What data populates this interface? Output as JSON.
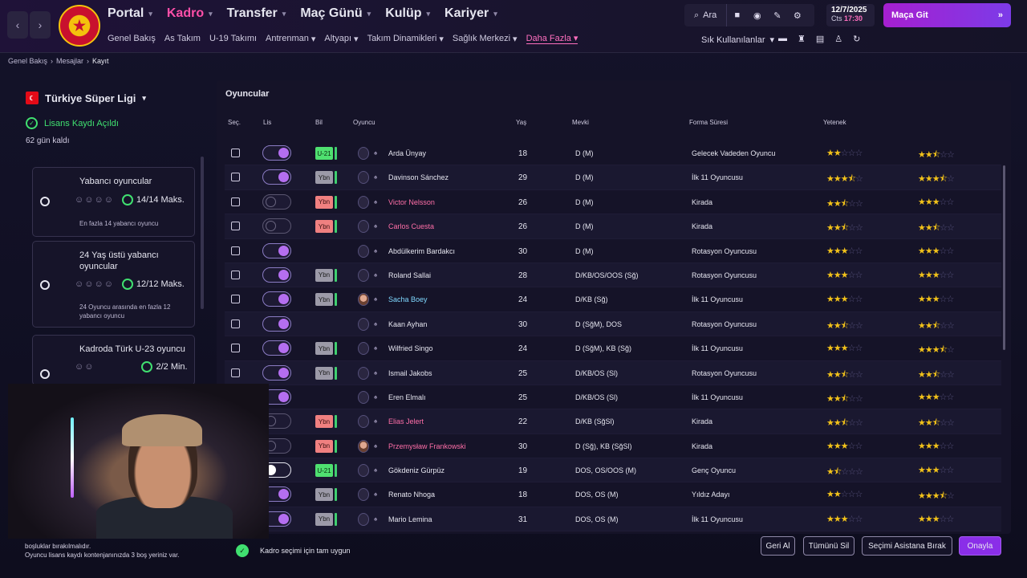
{
  "topbar": {
    "main_nav": [
      "Portal",
      "Kadro",
      "Transfer",
      "Maç Günü",
      "Kulüp",
      "Kariyer"
    ],
    "active_main": "Kadro",
    "sub_nav": [
      "Genel Bakış",
      "As Takım",
      "U-19 Takımı",
      "Antrenman",
      "Altyapı",
      "Takım Dinamikleri",
      "Sağlık Merkezi",
      "Daha Fazla"
    ],
    "active_sub": "Daha Fazla",
    "search_label": "Ara",
    "date": "12/7/2025",
    "day": "Cts",
    "time": "17:30",
    "continue_label": "Maça Git",
    "shortcuts_label": "Sık Kullanılanlar"
  },
  "breadcrumb": [
    "Genel Bakış",
    "Mesajlar",
    "Kayıt"
  ],
  "left": {
    "league": "Türkiye Süper Ligi",
    "license_status": "Lisans Kaydı Açıldı",
    "days_left": "62 gün kaldı",
    "rules": [
      {
        "title": "Yabancı oyuncular",
        "stat": "14/14 Maks.",
        "desc": "En fazla 14 yabancı oyuncu"
      },
      {
        "title": "24 Yaş üstü yabancı oyuncular",
        "stat": "12/12 Maks.",
        "desc": "24 Oyuncu arasında en fazla 12 yabancı oyuncu"
      },
      {
        "title": "Kadroda Türk U-23 oyuncu",
        "stat": "2/2 Min.",
        "desc": ""
      }
    ],
    "notes": [
      "boşluklar bırakılmalıdır.",
      "Oyuncu lisans kaydı kontenjanınızda 3 boş yeriniz var."
    ]
  },
  "table": {
    "title": "Oyuncular",
    "headers": [
      "Seç.",
      "Lis",
      "Bil",
      "Oyuncu",
      "Yaş",
      "Mevki",
      "Forma Süresi",
      "Yetenek"
    ],
    "rows": [
      {
        "name": "Arda Ünyay",
        "age": "18",
        "pos": "D (M)",
        "role": "Gelecek Vadeden Oyuncu",
        "badge": "U-21",
        "toggle": "on",
        "name_style": "normal",
        "ability": 2,
        "potential": 2.5
      },
      {
        "name": "Davinson Sánchez",
        "age": "29",
        "pos": "D (M)",
        "role": "İlk 11 Oyuncusu",
        "badge": "Ybn",
        "toggle": "on",
        "name_style": "normal",
        "ability": 3.5,
        "potential": 3.5
      },
      {
        "name": "Victor Nelsson",
        "age": "26",
        "pos": "D (M)",
        "role": "Kirada",
        "badge": "Ybn-red",
        "toggle": "off",
        "name_style": "loan",
        "ability": 2.5,
        "potential": 3
      },
      {
        "name": "Carlos Cuesta",
        "age": "26",
        "pos": "D (M)",
        "role": "Kirada",
        "badge": "Ybn-red",
        "toggle": "off",
        "name_style": "loan",
        "ability": 2.5,
        "potential": 2.5
      },
      {
        "name": "Abdülkerim Bardakcı",
        "age": "30",
        "pos": "D (M)",
        "role": "Rotasyon Oyuncusu",
        "badge": "",
        "toggle": "on",
        "name_style": "normal",
        "ability": 3,
        "potential": 3
      },
      {
        "name": "Roland Sallai",
        "age": "28",
        "pos": "D/KB/OS/OOS (Sğ)",
        "role": "Rotasyon Oyuncusu",
        "badge": "Ybn",
        "toggle": "on",
        "name_style": "normal",
        "ability": 3,
        "potential": 3
      },
      {
        "name": "Sacha Boey",
        "age": "24",
        "pos": "D/KB (Sğ)",
        "role": "İlk 11 Oyuncusu",
        "badge": "Ybn",
        "toggle": "on",
        "name_style": "new",
        "ability": 3,
        "potential": 3
      },
      {
        "name": "Kaan Ayhan",
        "age": "30",
        "pos": "D (SğM), DOS",
        "role": "Rotasyon Oyuncusu",
        "badge": "",
        "toggle": "on",
        "name_style": "normal",
        "ability": 2.5,
        "potential": 2.5
      },
      {
        "name": "Wilfried Singo",
        "age": "24",
        "pos": "D (SğM), KB (Sğ)",
        "role": "İlk 11 Oyuncusu",
        "badge": "Ybn",
        "toggle": "on",
        "name_style": "normal",
        "ability": 3,
        "potential": 3.5
      },
      {
        "name": "Ismail Jakobs",
        "age": "25",
        "pos": "D/KB/OS (Sl)",
        "role": "Rotasyon Oyuncusu",
        "badge": "Ybn",
        "toggle": "on",
        "name_style": "normal",
        "ability": 2.5,
        "potential": 2.5
      },
      {
        "name": "Eren Elmalı",
        "age": "25",
        "pos": "D/KB/OS (Sl)",
        "role": "İlk 11 Oyuncusu",
        "badge": "",
        "toggle": "on",
        "name_style": "normal",
        "ability": 2.5,
        "potential": 3
      },
      {
        "name": "Elias Jelert",
        "age": "22",
        "pos": "D/KB (SğSl)",
        "role": "Kirada",
        "badge": "Ybn-red",
        "toggle": "off",
        "name_style": "loan",
        "ability": 2.5,
        "potential": 2.5
      },
      {
        "name": "Przemysław Frankowski",
        "age": "30",
        "pos": "D (Sğ), KB (SğSl)",
        "role": "Kirada",
        "badge": "Ybn-red",
        "toggle": "off",
        "name_style": "loan",
        "ability": 3,
        "potential": 3
      },
      {
        "name": "Gökdeniz Gürpüz",
        "age": "19",
        "pos": "DOS, OS/OOS (M)",
        "role": "Genç Oyuncu",
        "badge": "U-21",
        "toggle": "white",
        "name_style": "normal",
        "ability": 1.5,
        "potential": 3
      },
      {
        "name": "Renato Nhoga",
        "age": "18",
        "pos": "DOS, OS (M)",
        "role": "Yıldız Adayı",
        "badge": "Ybn",
        "toggle": "on",
        "name_style": "normal",
        "ability": 2,
        "potential": 3.5
      },
      {
        "name": "Mario Lemina",
        "age": "31",
        "pos": "DOS, OS (M)",
        "role": "İlk 11 Oyuncusu",
        "badge": "Ybn",
        "toggle": "on",
        "name_style": "normal",
        "ability": 3,
        "potential": 3
      }
    ]
  },
  "footer": {
    "status": "Kadro seçimi için tam uygun",
    "buttons": [
      "Geri Al",
      "Tümünü Sil",
      "Seçimi Asistana Bırak",
      "Onayla"
    ]
  },
  "colors": {
    "accent": "#ff4fa8",
    "primary_button": "#8a2ee8",
    "ok_green": "#40e070",
    "star": "#f2c21a"
  }
}
